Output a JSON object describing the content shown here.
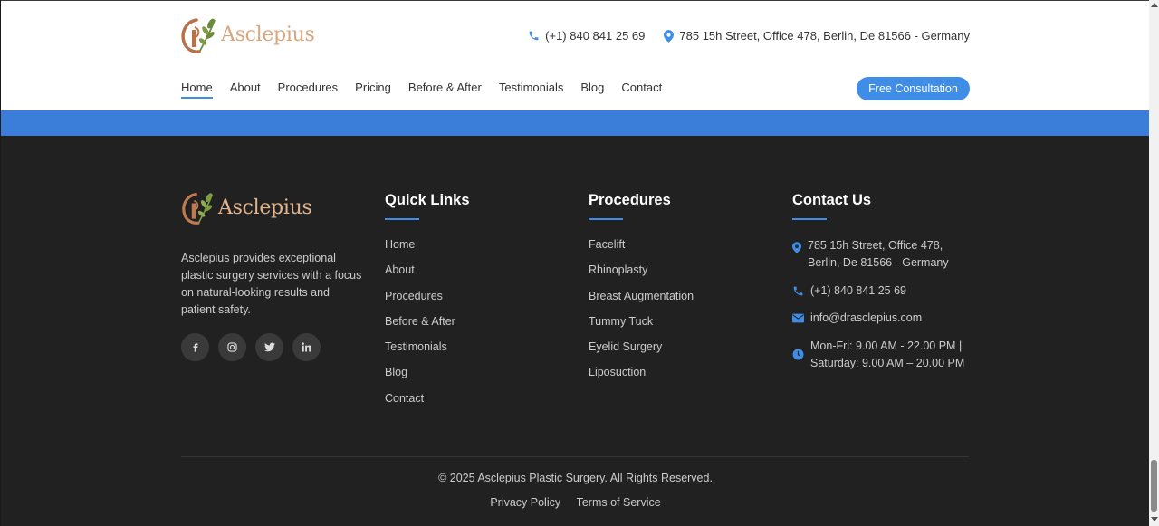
{
  "brand": {
    "name": "Asclepius"
  },
  "header": {
    "phone": "(+1) 840 841 25 69",
    "address": "785 15h Street, Office 478, Berlin, De 81566 - Germany",
    "nav": [
      "Home",
      "About",
      "Procedures",
      "Pricing",
      "Before & After",
      "Testimonials",
      "Blog",
      "Contact"
    ],
    "active_nav": "Home",
    "cta": "Free Consultation"
  },
  "footer": {
    "description": "Asclepius provides exceptional plastic surgery services with a focus on natural-looking results and patient safety.",
    "social": [
      "facebook-icon",
      "instagram-icon",
      "twitter-icon",
      "linkedin-icon"
    ],
    "quick_links": {
      "title": "Quick Links",
      "items": [
        "Home",
        "About",
        "Procedures",
        "Before & After",
        "Testimonials",
        "Blog",
        "Contact"
      ]
    },
    "procedures": {
      "title": "Procedures",
      "items": [
        "Facelift",
        "Rhinoplasty",
        "Breast Augmentation",
        "Tummy Tuck",
        "Eyelid Surgery",
        "Liposuction"
      ]
    },
    "contact": {
      "title": "Contact Us",
      "address": "785 15h Street, Office 478, Berlin, De 81566 - Germany",
      "phone": "(+1) 840 841 25 69",
      "email": "info@drasclepius.com",
      "hours": "Mon-Fri: 9.00 AM - 22.00 PM | Saturday: 9.00 AM – 20.00 PM"
    },
    "copyright": "© 2025 Asclepius Plastic Surgery. All Rights Reserved.",
    "privacy": "Privacy Policy",
    "terms": "Terms of Service"
  },
  "colors": {
    "accent": "#3f8de6",
    "footer_bg": "#212121",
    "logo_text": "#d9a57c"
  }
}
